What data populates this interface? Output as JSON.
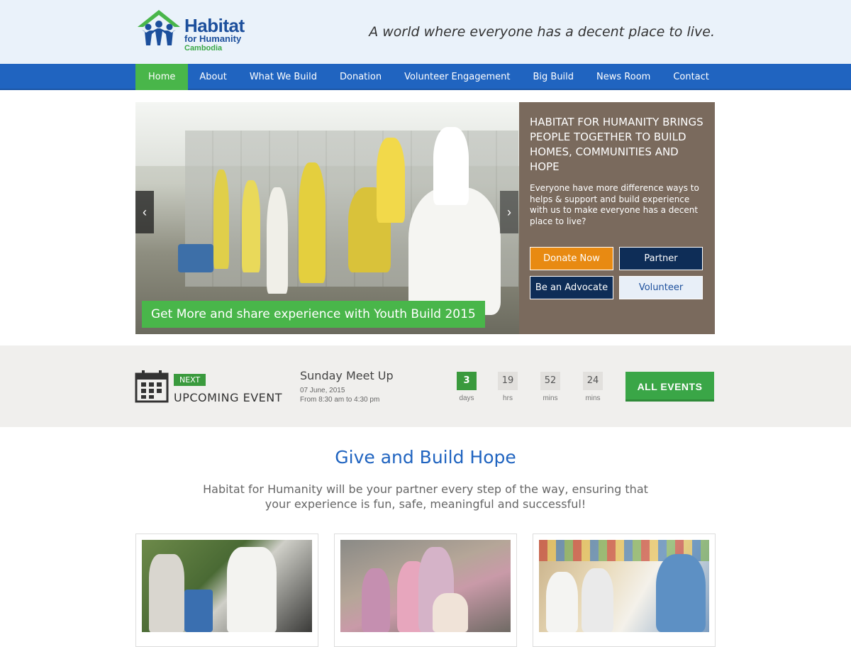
{
  "header": {
    "logo": {
      "title": "Habitat",
      "subtitle": "for Humanity",
      "country": "Cambodia"
    },
    "tagline": "A world where everyone has a decent place to live."
  },
  "nav": {
    "items": [
      {
        "label": "Home",
        "active": true
      },
      {
        "label": "About",
        "active": false
      },
      {
        "label": "What We Build",
        "active": false
      },
      {
        "label": "Donation",
        "active": false
      },
      {
        "label": "Volunteer Engagement",
        "active": false
      },
      {
        "label": "Big Build",
        "active": false
      },
      {
        "label": "News Room",
        "active": false
      },
      {
        "label": "Contact",
        "active": false
      }
    ]
  },
  "hero": {
    "caption": "Get More and share experience with Youth Build 2015",
    "heading": "HABITAT FOR HUMANITY BRINGS PEOPLE TOGETHER TO BUILD HOMES, COMMUNITIES AND HOPE",
    "text": "Everyone have more difference ways to helps & support and build experience with us to make everyone has a decent place to live?",
    "buttons": {
      "donate": "Donate Now",
      "partner": "Partner",
      "advocate": "Be an Advocate",
      "volunteer": "Volunteer"
    },
    "prev_icon": "chevron-left-icon",
    "next_icon": "chevron-right-icon"
  },
  "events": {
    "badge": "NEXT",
    "label": "UPCOMING EVENT",
    "title": "Sunday Meet Up",
    "date": "07 June, 2015",
    "time": "From 8:30 am to 4:30 pm",
    "countdown": [
      {
        "value": "3",
        "unit": "days"
      },
      {
        "value": "19",
        "unit": "hrs"
      },
      {
        "value": "52",
        "unit": "mins"
      },
      {
        "value": "24",
        "unit": "mins"
      }
    ],
    "all_events": "ALL EVENTS"
  },
  "give": {
    "title": "Give and Build Hope",
    "text": "Habitat for Humanity will be your partner every step of the way, ensuring that your experience is fun, safe, meaningful and successful!"
  },
  "colors": {
    "brand_blue": "#2064c0",
    "brand_green": "#49b64a",
    "orange": "#e88a12",
    "navy": "#0e2d57",
    "panel_brown": "#7a6a5d"
  }
}
